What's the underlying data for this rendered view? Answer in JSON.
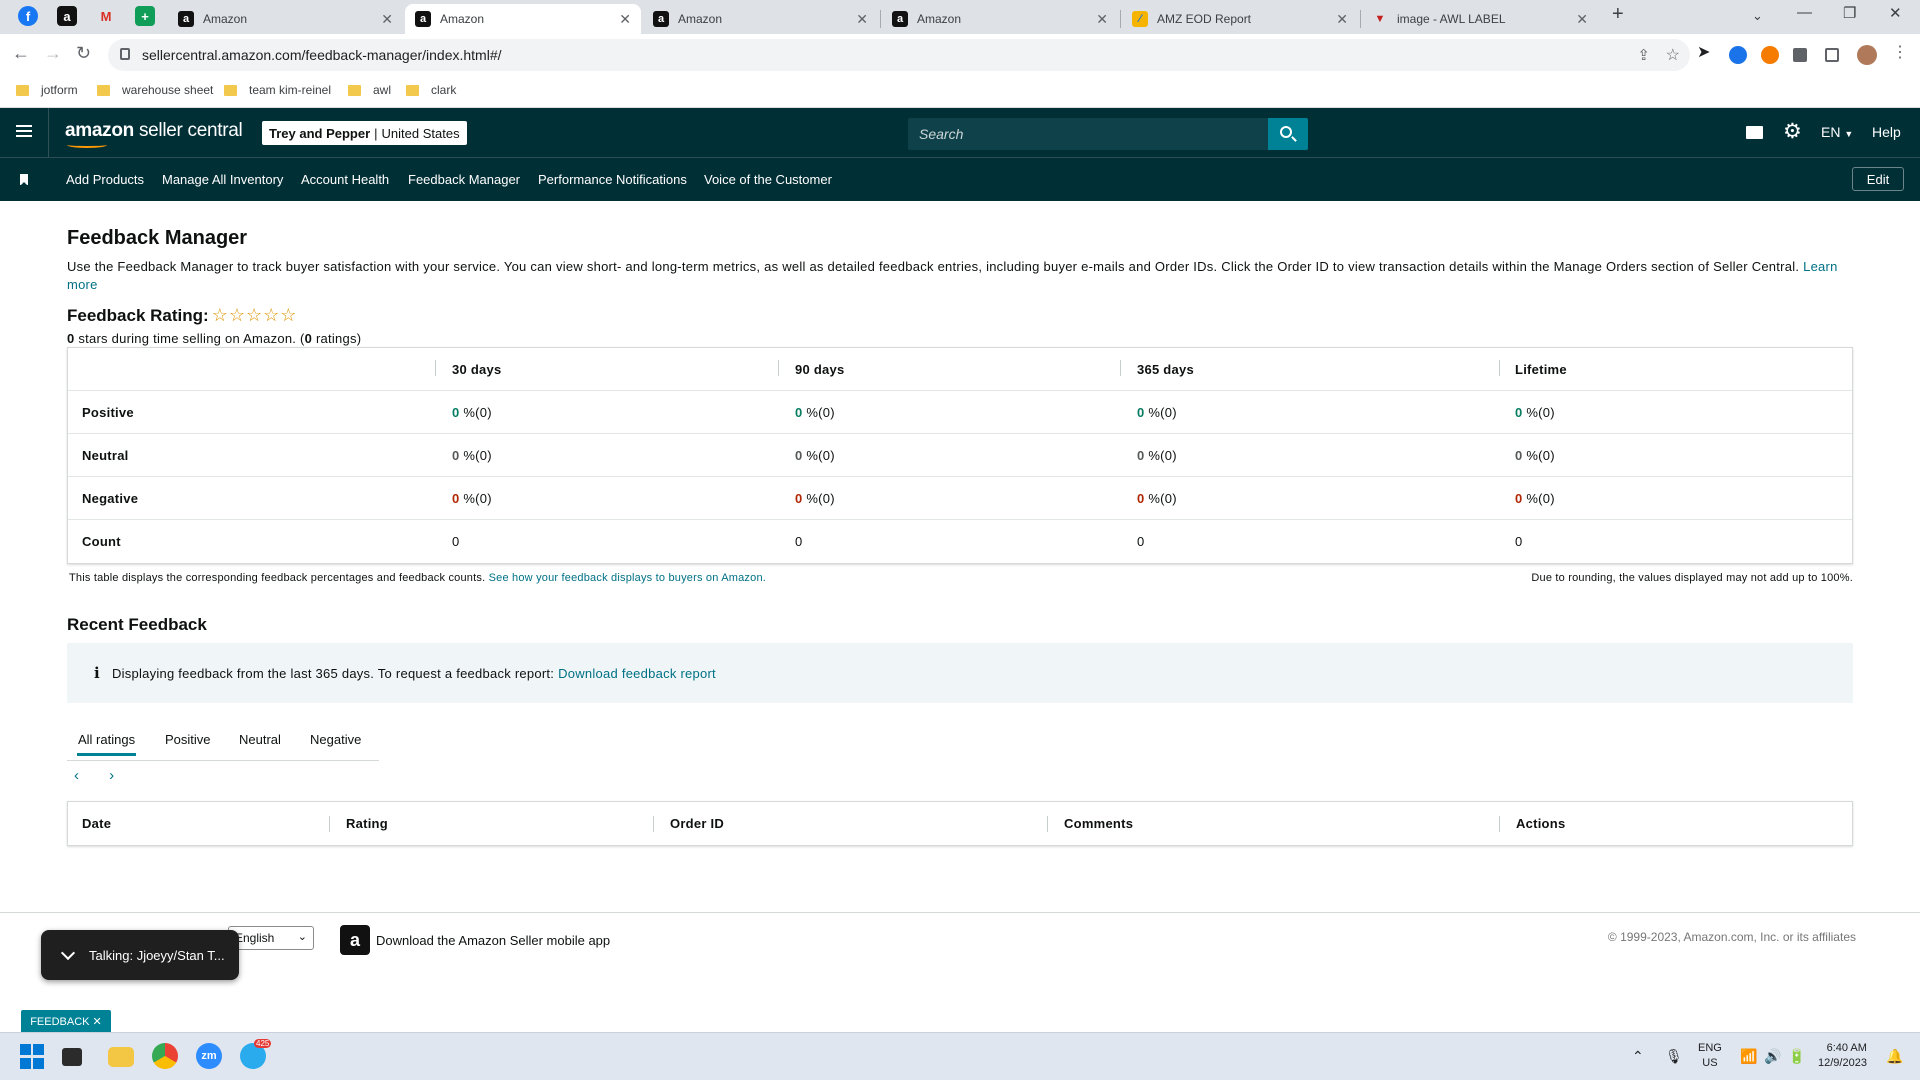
{
  "browser": {
    "tabs": [
      {
        "title": "Amazon",
        "active": false
      },
      {
        "title": "Amazon",
        "active": true
      },
      {
        "title": "Amazon",
        "active": false
      },
      {
        "title": "Amazon",
        "active": false
      },
      {
        "title": "AMZ EOD Report",
        "active": false
      },
      {
        "title": "image - AWL LABEL",
        "active": false
      }
    ],
    "new_tab": "+",
    "url": "sellercentral.amazon.com/feedback-manager/index.html#/",
    "bookmarks": [
      "jotform",
      "warehouse sheet",
      "team kim-reinel",
      "awl",
      "clark"
    ]
  },
  "header": {
    "logo_main": "amazon",
    "logo_sub": "seller central",
    "account_name": "Trey and Pepper",
    "account_region": "United States",
    "search_placeholder": "Search",
    "language": "EN",
    "help": "Help"
  },
  "nav": {
    "links": [
      "Add Products",
      "Manage All Inventory",
      "Account Health",
      "Feedback Manager",
      "Performance Notifications",
      "Voice of the Customer"
    ],
    "edit": "Edit"
  },
  "page": {
    "title": "Feedback Manager",
    "intro": "Use the Feedback Manager to track buyer satisfaction with your service. You can view short- and long-term metrics, as well as detailed feedback entries, including buyer e-mails and Order IDs. Click the Order ID to view transaction details within the Manage Orders section of Seller Central.",
    "learn_more": "Learn more",
    "rating_title": "Feedback Rating:",
    "stars": "☆☆☆☆☆",
    "rating_stars_value": 0,
    "rating_sub_a": "0",
    "rating_sub_b": " stars during time selling on Amazon. (",
    "rating_sub_c": "0",
    "rating_sub_d": " ratings)"
  },
  "feedback_table": {
    "columns": [
      "30 days",
      "90 days",
      "365 days",
      "Lifetime"
    ],
    "rows": [
      {
        "label": "Positive",
        "type": "pos",
        "values": [
          {
            "pct": "0",
            "rest": " %(0)"
          },
          {
            "pct": "0",
            "rest": " %(0)"
          },
          {
            "pct": "0",
            "rest": " %(0)"
          },
          {
            "pct": "0",
            "rest": " %(0)"
          }
        ]
      },
      {
        "label": "Neutral",
        "type": "neu",
        "values": [
          {
            "pct": "0",
            "rest": " %(0)"
          },
          {
            "pct": "0",
            "rest": " %(0)"
          },
          {
            "pct": "0",
            "rest": " %(0)"
          },
          {
            "pct": "0",
            "rest": " %(0)"
          }
        ]
      },
      {
        "label": "Negative",
        "type": "neg",
        "values": [
          {
            "pct": "0",
            "rest": " %(0)"
          },
          {
            "pct": "0",
            "rest": " %(0)"
          },
          {
            "pct": "0",
            "rest": " %(0)"
          },
          {
            "pct": "0",
            "rest": " %(0)"
          }
        ]
      },
      {
        "label": "Count",
        "type": "count",
        "values": [
          {
            "pct": "",
            "rest": "0"
          },
          {
            "pct": "",
            "rest": "0"
          },
          {
            "pct": "",
            "rest": "0"
          },
          {
            "pct": "",
            "rest": "0"
          }
        ]
      }
    ],
    "note": "This table displays the corresponding feedback percentages and feedback counts.",
    "note_link": "See how your feedback displays to buyers on Amazon.",
    "rounding_note": "Due to rounding, the values displayed may not add up to 100%."
  },
  "recent": {
    "title": "Recent Feedback",
    "info_icon": "i",
    "info_text": "Displaying feedback from the last 365 days. To request a feedback report:",
    "info_link": "Download feedback report",
    "tabs": [
      "All ratings",
      "Positive",
      "Neutral",
      "Negative"
    ],
    "pager": "‹ ›",
    "columns": [
      "Date",
      "Rating",
      "Order ID",
      "Comments",
      "Actions"
    ]
  },
  "footer": {
    "language_select": "English",
    "app_logo": "a",
    "app_text": "Download the Amazon Seller mobile app",
    "copyright": "© 1999-2023, Amazon.com, Inc. or its affiliates"
  },
  "overlays": {
    "talking": "Talking: Jjoeyy/Stan T...",
    "feedback_tab": "FEEDBACK ✕"
  },
  "taskbar": {
    "lang_top": "ENG",
    "lang_bottom": "US",
    "time": "6:40 AM",
    "date": "12/9/2023",
    "telegram_badge": "425"
  },
  "colors": {
    "header_bg": "#002f36",
    "accent": "#008296",
    "link": "#007185",
    "positive": "#067d62",
    "negative": "#b12704"
  }
}
